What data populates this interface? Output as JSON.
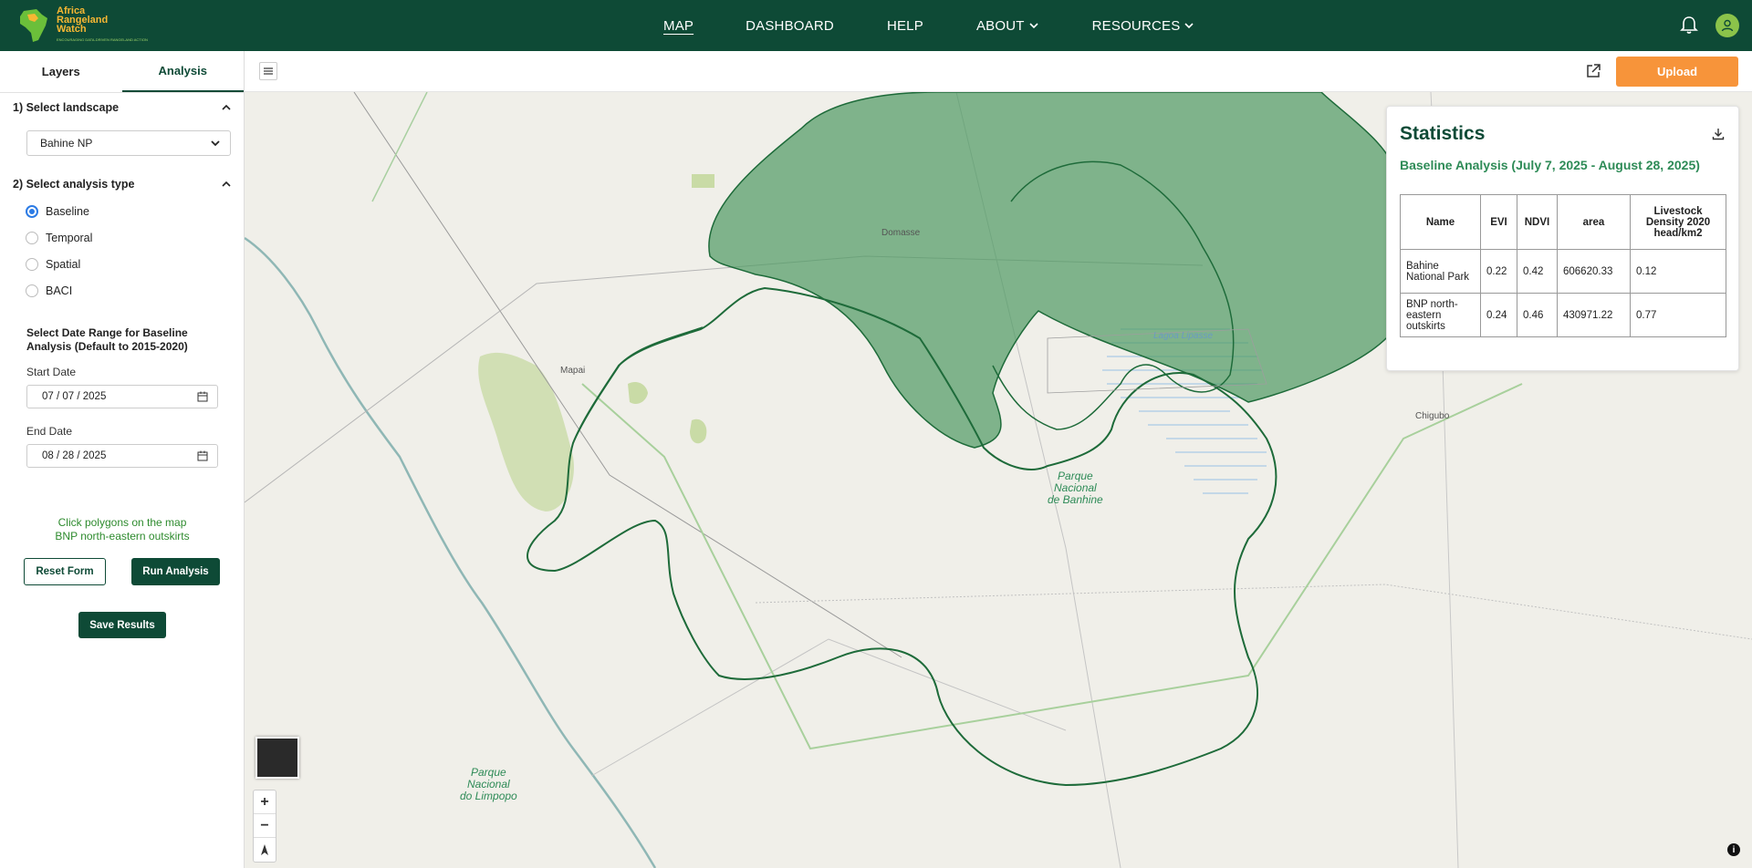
{
  "brand": {
    "line1": "Africa",
    "line2": "Rangeland",
    "line3": "Watch",
    "tagline": "ENCOURAGING DATA-DRIVEN RANGELAND ACTION"
  },
  "nav": {
    "map": "MAP",
    "dashboard": "DASHBOARD",
    "help": "HELP",
    "about": "ABOUT",
    "resources": "RESOURCES"
  },
  "tabs": {
    "layers": "Layers",
    "analysis": "Analysis"
  },
  "form": {
    "section1": "1) Select landscape",
    "landscape_value": "Bahine NP",
    "section2": "2) Select analysis type",
    "analysis_types": [
      "Baseline",
      "Temporal",
      "Spatial",
      "BACI"
    ],
    "selected_type": "Baseline",
    "date_range_title": "Select Date Range for Baseline Analysis (Default to 2015-2020)",
    "start_label": "Start Date",
    "start_value": "07 / 07 / 2025",
    "end_label": "End Date",
    "end_value": "08 / 28 / 2025",
    "hint_line1": "Click polygons on the map",
    "hint_line2": "BNP north-eastern outskirts",
    "reset": "Reset Form",
    "run": "Run Analysis",
    "save": "Save Results"
  },
  "toolbar": {
    "upload": "Upload"
  },
  "map_labels": {
    "domasse": "Domasse",
    "mapai": "Mapai",
    "chigubo": "Chigubo",
    "lagoa": "Lagoa Lipasse",
    "park1_l1": "Parque",
    "park1_l2": "Nacional",
    "park1_l3": "de Banhine",
    "park2_l1": "Parque",
    "park2_l2": "Nacional",
    "park2_l3": "do Limpopo"
  },
  "zoom": {
    "in": "+",
    "out": "−"
  },
  "stats": {
    "title": "Statistics",
    "subtitle": "Baseline Analysis (July 7, 2025 - August 28, 2025)",
    "headers": [
      "Name",
      "EVI",
      "NDVI",
      "area",
      "Livestock Density 2020 head/km2"
    ],
    "rows": [
      [
        "Bahine National Park",
        "0.22",
        "0.42",
        "606620.33",
        "0.12"
      ],
      [
        "BNP north-eastern outskirts",
        "0.24",
        "0.46",
        "430971.22",
        "0.77"
      ]
    ]
  },
  "colors": {
    "header": "#0e4a36",
    "accent": "#f7943a",
    "polygon": "#2e7d4f"
  }
}
